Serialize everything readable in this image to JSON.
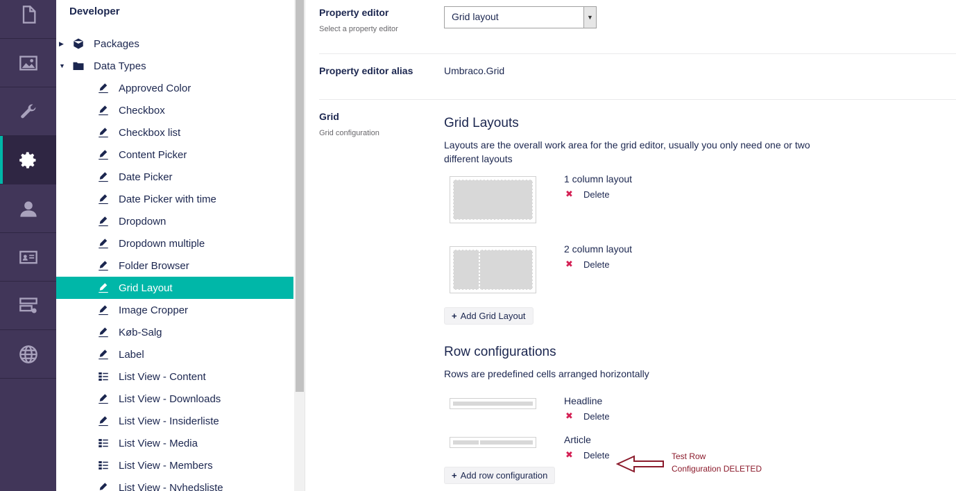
{
  "rail": {
    "items": [
      {
        "name": "content-icon"
      },
      {
        "name": "media-icon"
      },
      {
        "name": "settings-wrench-icon"
      },
      {
        "name": "developer-gear-icon",
        "active": true
      },
      {
        "name": "users-icon"
      },
      {
        "name": "members-card-icon"
      },
      {
        "name": "forms-icon"
      },
      {
        "name": "translation-globe-icon"
      }
    ]
  },
  "tree": {
    "title": "Developer",
    "items": [
      {
        "label": "Packages",
        "icon": "package-icon",
        "caret": "▶",
        "indent": 0
      },
      {
        "label": "Data Types",
        "icon": "folder-icon",
        "caret": "▼",
        "indent": 0
      },
      {
        "label": "Approved Color",
        "icon": "autofill-icon",
        "indent": 1
      },
      {
        "label": "Checkbox",
        "icon": "autofill-icon",
        "indent": 1
      },
      {
        "label": "Checkbox list",
        "icon": "autofill-icon",
        "indent": 1
      },
      {
        "label": "Content Picker",
        "icon": "autofill-icon",
        "indent": 1
      },
      {
        "label": "Date Picker",
        "icon": "autofill-icon",
        "indent": 1
      },
      {
        "label": "Date Picker with time",
        "icon": "autofill-icon",
        "indent": 1
      },
      {
        "label": "Dropdown",
        "icon": "autofill-icon",
        "indent": 1
      },
      {
        "label": "Dropdown multiple",
        "icon": "autofill-icon",
        "indent": 1
      },
      {
        "label": "Folder Browser",
        "icon": "autofill-icon",
        "indent": 1
      },
      {
        "label": "Grid Layout",
        "icon": "autofill-icon",
        "indent": 1,
        "selected": true
      },
      {
        "label": "Image Cropper",
        "icon": "autofill-icon",
        "indent": 1
      },
      {
        "label": "Køb-Salg",
        "icon": "autofill-icon",
        "indent": 1
      },
      {
        "label": "Label",
        "icon": "autofill-icon",
        "indent": 1
      },
      {
        "label": "List View - Content",
        "icon": "thumbnail-list-icon",
        "indent": 1
      },
      {
        "label": "List View - Downloads",
        "icon": "autofill-icon",
        "indent": 1
      },
      {
        "label": "List View - Insiderliste",
        "icon": "autofill-icon",
        "indent": 1
      },
      {
        "label": "List View - Media",
        "icon": "thumbnail-list-icon",
        "indent": 1
      },
      {
        "label": "List View - Members",
        "icon": "thumbnail-list-icon",
        "indent": 1
      },
      {
        "label": "List View - Nyhedsliste",
        "icon": "autofill-icon",
        "indent": 1
      }
    ]
  },
  "editor": {
    "property_editor_label": "Property editor",
    "property_editor_desc": "Select a property editor",
    "property_editor_value": "Grid layout",
    "alias_label": "Property editor alias",
    "alias_value": "Umbraco.Grid",
    "grid_label": "Grid",
    "grid_desc": "Grid configuration"
  },
  "grid_layouts": {
    "title": "Grid Layouts",
    "description": "Layouts are the overall work area for the grid editor, usually you only need one or two different layouts",
    "items": [
      {
        "name": "1 column layout",
        "delete": "Delete"
      },
      {
        "name": "2 column layout",
        "delete": "Delete"
      }
    ],
    "add_button": "Add Grid Layout"
  },
  "row_configs": {
    "title": "Row configurations",
    "description": "Rows are predefined cells arranged horizontally",
    "items": [
      {
        "name": "Headline",
        "delete": "Delete"
      },
      {
        "name": "Article",
        "delete": "Delete"
      }
    ],
    "add_button": "Add row configuration"
  },
  "annotation": {
    "line1": "Test Row",
    "line2": "Configuration DELETED",
    "color": "#8b1a2b"
  },
  "colors": {
    "rail_bg": "#413659",
    "accent": "#00b7a8",
    "delete_red": "#d42054"
  }
}
